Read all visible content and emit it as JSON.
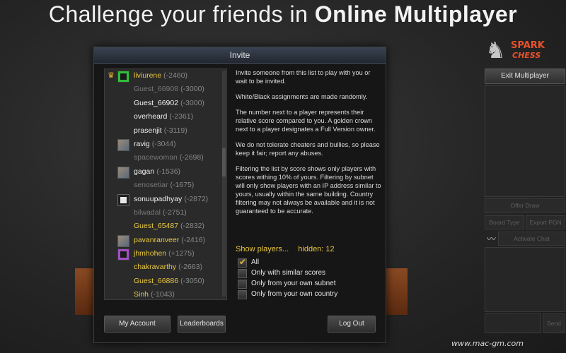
{
  "headline": {
    "part1": "Challenge your friends in ",
    "part2": "Online Multiplayer"
  },
  "dialog": {
    "title": "Invite",
    "players": [
      {
        "name": "liviurene",
        "score": "(-2460)",
        "crown": true,
        "avatar": "green-invader",
        "color": "#e8c940"
      },
      {
        "name": "Guest_66908",
        "score": "(-3000)",
        "crown": false,
        "avatar": "",
        "color": "#777777"
      },
      {
        "name": "Guest_66902",
        "score": "(-3000)",
        "crown": false,
        "avatar": "",
        "color": "#f0f0f0"
      },
      {
        "name": "overheard",
        "score": "(-2361)",
        "crown": false,
        "avatar": "",
        "color": "#f0f0f0"
      },
      {
        "name": "prasenjit",
        "score": "(-3119)",
        "crown": false,
        "avatar": "",
        "color": "#f0f0f0"
      },
      {
        "name": "ravig",
        "score": "(-3044)",
        "crown": false,
        "avatar": "photo",
        "color": "#f0f0f0"
      },
      {
        "name": "spacewoman",
        "score": "(-2698)",
        "crown": false,
        "avatar": "",
        "color": "#777777"
      },
      {
        "name": "gagan",
        "score": "(-1536)",
        "crown": false,
        "avatar": "photo",
        "color": "#f0f0f0"
      },
      {
        "name": "senosetiar",
        "score": "(-1675)",
        "crown": false,
        "avatar": "",
        "color": "#777777"
      },
      {
        "name": "sonuupadhyay",
        "score": "(-2872)",
        "crown": false,
        "avatar": "invader",
        "color": "#f0f0f0"
      },
      {
        "name": "bilwadal",
        "score": "(-2751)",
        "crown": false,
        "avatar": "",
        "color": "#777777"
      },
      {
        "name": "Guest_65487",
        "score": "(-2832)",
        "crown": false,
        "avatar": "",
        "color": "#e8c940"
      },
      {
        "name": "pavanranveer",
        "score": "(-2416)",
        "crown": false,
        "avatar": "photo",
        "color": "#e8c940"
      },
      {
        "name": "jhmhohen",
        "score": "(+1275)",
        "crown": false,
        "avatar": "purple-invader",
        "color": "#e8c940"
      },
      {
        "name": "chakravarthy",
        "score": "(-2663)",
        "crown": false,
        "avatar": "",
        "color": "#e8c940"
      },
      {
        "name": "Guest_66886",
        "score": "(-3050)",
        "crown": false,
        "avatar": "",
        "color": "#e8c940"
      },
      {
        "name": "Sinh",
        "score": "(-1043)",
        "crown": false,
        "avatar": "",
        "color": "#e8c940"
      }
    ],
    "info": {
      "p1": "Invite someone from this list to play with you or wait to be invited.",
      "p2": "White/Black assignments are made randomly.",
      "p3": "The number next to a player represents their relative score compared to you. A golden crown next to a player designates a Full Version owner.",
      "p4": "We do not tolerate cheaters and bullies, so please keep it fair; report any abuses.",
      "p5": "Filtering the list by score shows only players with scores withing 10% of yours. Filtering by subnet will only show players with an IP address similar to yours, usually within the same building. Country filtering may not always be available and it is not guaranteed to be accurate."
    },
    "show_players": "Show players...",
    "hidden": "hidden: 12",
    "filters": [
      {
        "label": "All",
        "checked": true
      },
      {
        "label": "Only with similar scores",
        "checked": false
      },
      {
        "label": "Only from your own subnet",
        "checked": false
      },
      {
        "label": "Only from your own country",
        "checked": false
      }
    ],
    "buttons": {
      "my_account": "My Account",
      "leaderboards": "Leaderboards",
      "log_out": "Log Out"
    }
  },
  "right_panel": {
    "logo_line1": "SPARK",
    "logo_line2": "CHESS",
    "exit_multiplayer": "Exit Multiplayer",
    "offer_draw": "Offer Draw",
    "board_type": "Board Type",
    "export_pgn": "Export PGN",
    "activate_chat": "Activate Chat",
    "send": "Send"
  },
  "watermark": "www.mac-gm.com"
}
